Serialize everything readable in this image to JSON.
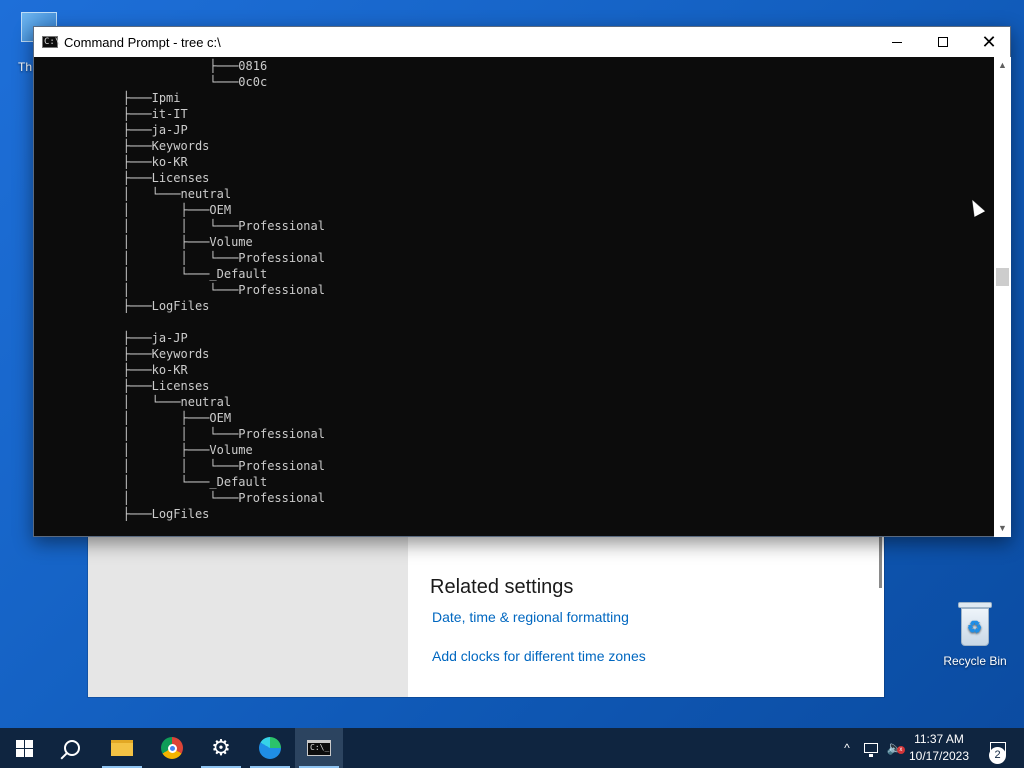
{
  "desktop": {
    "this_pc_label": "Th",
    "recycle_bin_label": "Recycle Bin"
  },
  "settings_window": {
    "heading": "Related settings",
    "link_formatting": "Date, time & regional formatting",
    "link_clocks": "Add clocks for different time zones"
  },
  "cmd_window": {
    "title": "Command Prompt - tree  c:\\",
    "icon_text": "C:\\",
    "close_glyph": "✕",
    "lines": [
      "                ├───0816",
      "                └───0c0c",
      "    ├───Ipmi",
      "    ├───it-IT",
      "    ├───ja-JP",
      "    ├───Keywords",
      "    ├───ko-KR",
      "    ├───Licenses",
      "    │   └───neutral",
      "    │       ├───OEM",
      "    │       │   └───Professional",
      "    │       ├───Volume",
      "    │       │   └───Professional",
      "    │       └───_Default",
      "    │           └───Professional",
      "    ├───LogFiles",
      "",
      "    ├───ja-JP",
      "    ├───Keywords",
      "    ├───ko-KR",
      "    ├───Licenses",
      "    │   └───neutral",
      "    │       ├───OEM",
      "    │       │   └───Professional",
      "    │       ├───Volume",
      "    │       │   └───Professional",
      "    │       └───_Default",
      "    │           └───Professional",
      "    ├───LogFiles"
    ]
  },
  "taskbar": {
    "cmd_icon_text": "C:\\_",
    "gear_glyph": "⚙",
    "chevron_glyph": "^",
    "volume_glyph": "🔈",
    "time": "11:37 AM",
    "date": "10/17/2023",
    "notification_count": "2"
  },
  "colors": {
    "desktop_accent": "#1664c7",
    "console_bg": "#0c0c0c",
    "console_text": "#cccccc",
    "link_blue": "#0067c0",
    "taskbar_bg": "#0f2540"
  }
}
